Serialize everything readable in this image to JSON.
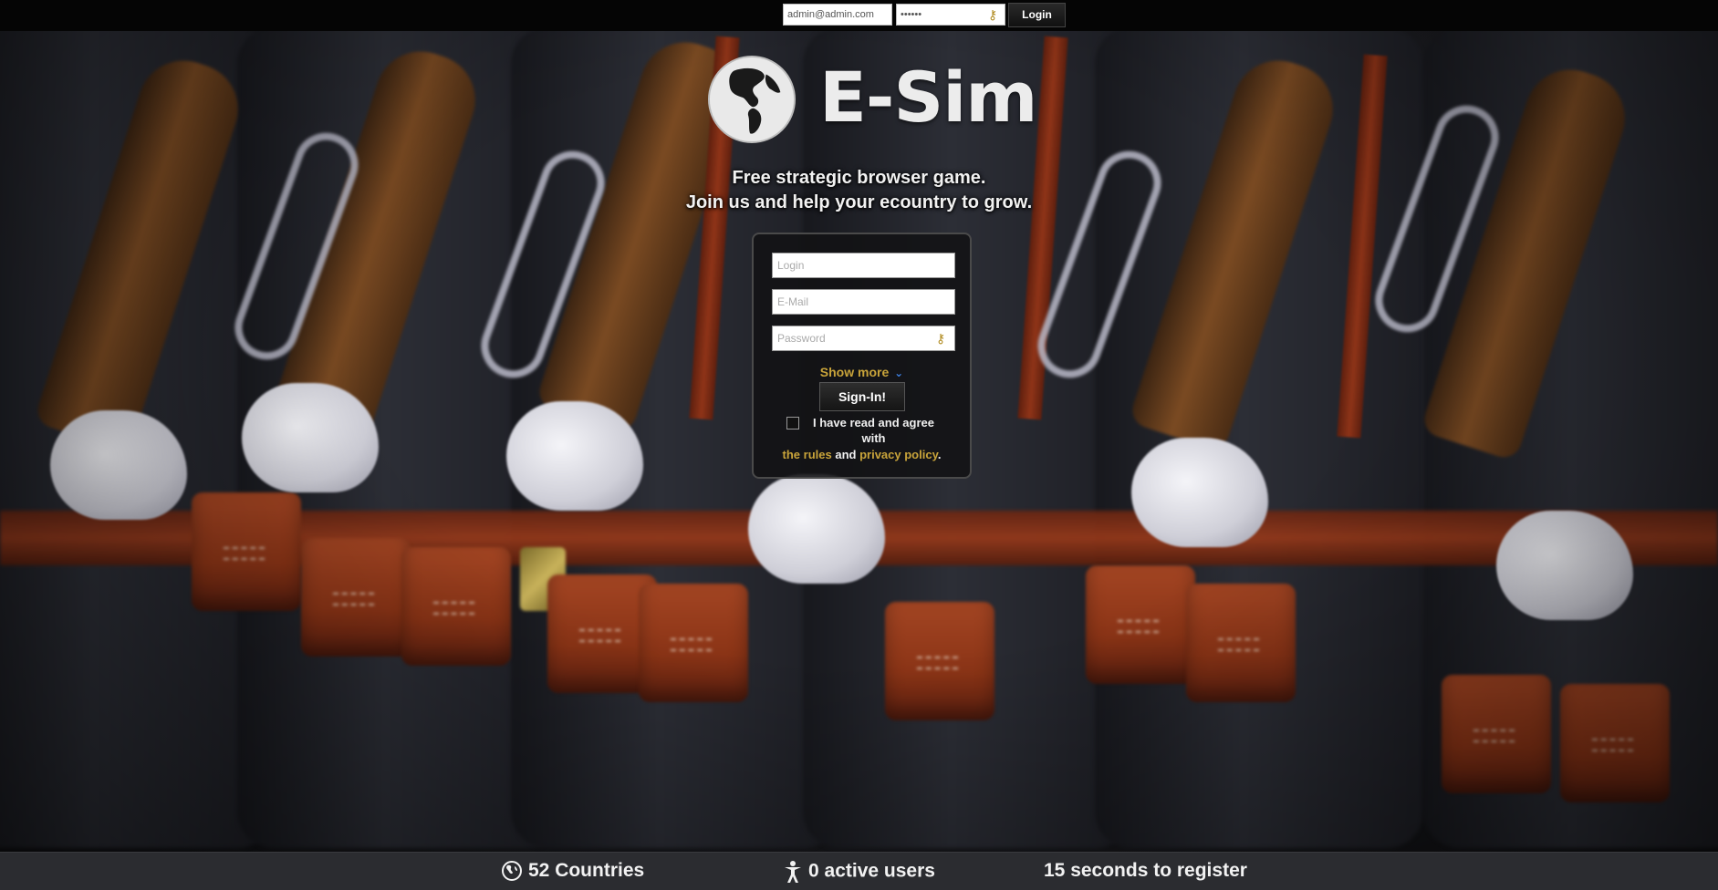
{
  "top_login": {
    "email_value": "admin@admin.com",
    "password_value": "••••••",
    "login_label": "Login"
  },
  "logo": {
    "title": "E-Sim"
  },
  "tagline": {
    "line1": "Free strategic browser game.",
    "line2": "Join us and help your ecountry to grow."
  },
  "signup": {
    "login_placeholder": "Login",
    "email_placeholder": "E-Mail",
    "password_placeholder": "Password",
    "show_more_label": "Show more",
    "signin_label": "Sign-In!",
    "agree_text": "I have read and agree with",
    "rules_link": "the rules",
    "and_text": "and",
    "privacy_link": "privacy policy",
    "period": "."
  },
  "stats": {
    "countries": "52 Countries",
    "active_users": "0 active users",
    "register": "15 seconds to register"
  },
  "colors": {
    "accent_gold": "#c9a43a",
    "chevron_blue": "#3d7fe0",
    "topbar": "#050505",
    "bottombar": "#2b2c30"
  },
  "icons": [
    "key-icon",
    "globe-logo-icon",
    "chevron-down-icon",
    "globe-icon",
    "person-icon"
  ]
}
